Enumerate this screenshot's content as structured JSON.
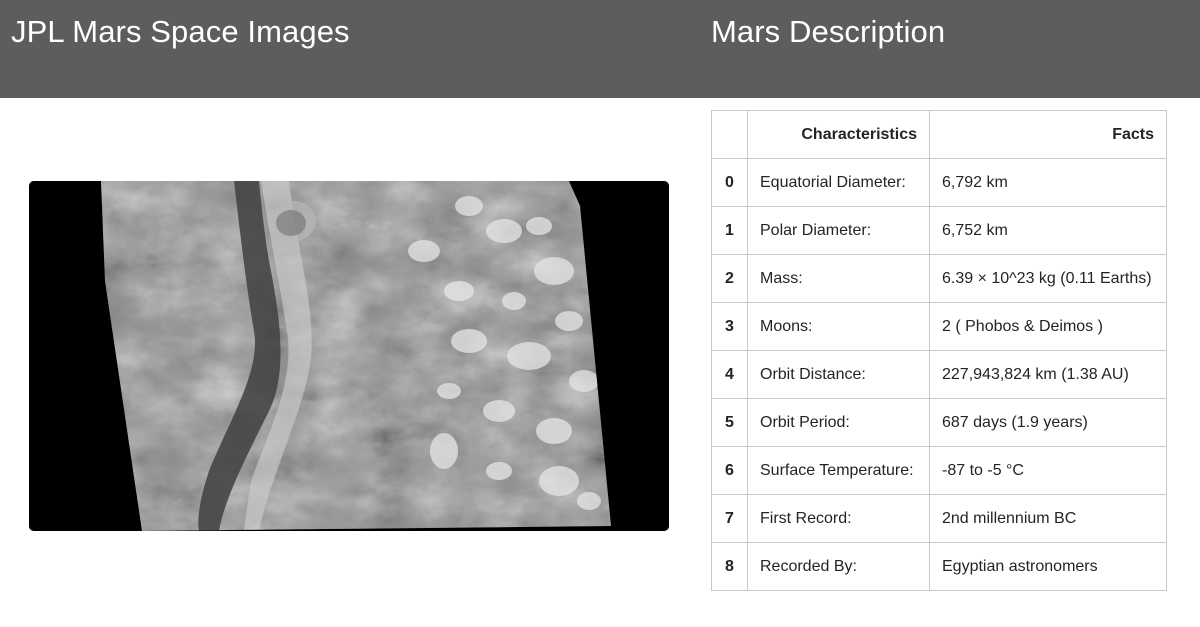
{
  "header": {
    "images_title": "JPL Mars Space Images",
    "description_title": "Mars Description"
  },
  "featured_image": {
    "description": "Mars surface image"
  },
  "facts_table": {
    "index_header": "",
    "columns": [
      "Characteristics",
      "Facts"
    ],
    "rows": [
      {
        "index": "0",
        "characteristic": "Equatorial Diameter:",
        "fact": "6,792 km"
      },
      {
        "index": "1",
        "characteristic": "Polar Diameter:",
        "fact": "6,752 km"
      },
      {
        "index": "2",
        "characteristic": "Mass:",
        "fact": "6.39 × 10^23 kg (0.11 Earths)"
      },
      {
        "index": "3",
        "characteristic": "Moons:",
        "fact": "2 ( Phobos & Deimos )"
      },
      {
        "index": "4",
        "characteristic": "Orbit Distance:",
        "fact": "227,943,824 km (1.38 AU)"
      },
      {
        "index": "5",
        "characteristic": "Orbit Period:",
        "fact": "687 days (1.9 years)"
      },
      {
        "index": "6",
        "characteristic": "Surface Temperature:",
        "fact": "-87 to -5 °C"
      },
      {
        "index": "7",
        "characteristic": "First Record:",
        "fact": "2nd millennium BC"
      },
      {
        "index": "8",
        "characteristic": "Recorded By:",
        "fact": "Egyptian astronomers"
      }
    ]
  }
}
